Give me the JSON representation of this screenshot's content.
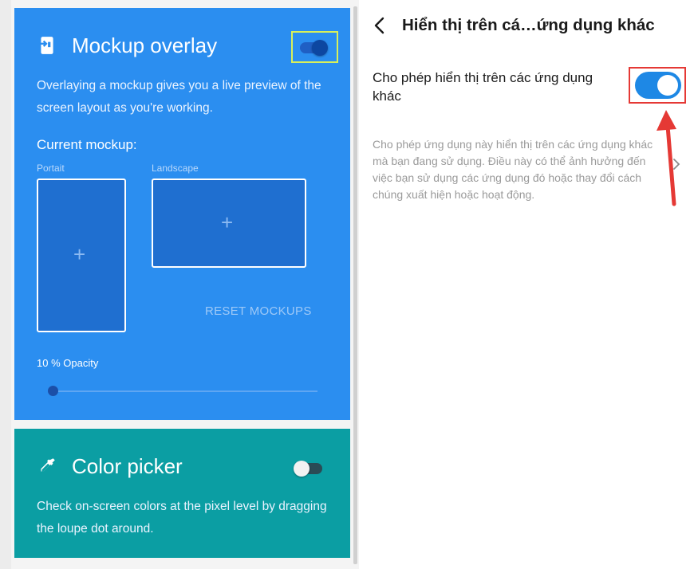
{
  "mockup_card": {
    "title": "Mockup overlay",
    "icon": "phone-import-icon",
    "description": "Overlaying a mockup gives you a live preview of the screen layout as you're working.",
    "toggle_on": true,
    "current_mockup_label": "Current mockup:",
    "portrait_label": "Portait",
    "landscape_label": "Landscape",
    "plus_symbol": "+",
    "reset_label": "RESET MOCKUPS",
    "opacity_label": "10 % Opacity",
    "opacity_value": 10,
    "colors": {
      "card": "#2b8ef0",
      "toggle_track": "#1f5fc4",
      "toggle_knob": "#0d47a1"
    }
  },
  "color_card": {
    "title": "Color picker",
    "icon": "eyedropper-icon",
    "description": "Check on-screen colors at the pixel level by dragging the loupe dot around.",
    "toggle_on": false,
    "colors": {
      "card": "#0b9ea3",
      "toggle_track": "#2a4b55",
      "toggle_knob": "#f2f2f2"
    }
  },
  "settings": {
    "back_icon": "chevron-left-icon",
    "title": "Hiển thị trên cá…ứng dụng khác",
    "setting_label": "Cho phép hiển thị trên các ứng dụng khác",
    "toggle_on": true,
    "description": "Cho phép ứng dụng này hiển thị trên các ứng dụng khác mà bạn đang sử dụng. Điều này có thể ảnh hưởng đến việc bạn sử dụng các ứng dụng đó hoặc thay đổi cách chúng xuất hiện hoặc hoạt động.",
    "chevron_icon": "chevron-right-icon",
    "colors": {
      "accent": "#1e88e5",
      "highlight_box": "#e53935",
      "arrow": "#e53935"
    }
  }
}
